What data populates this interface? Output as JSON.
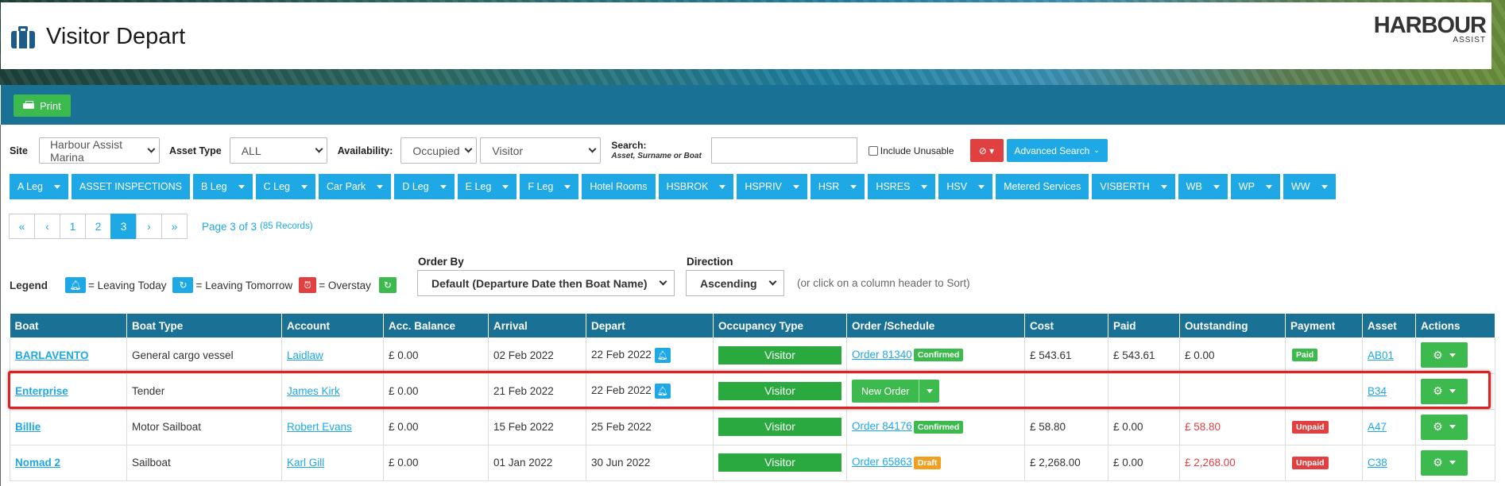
{
  "header": {
    "title": "Visitor Depart",
    "logo_brand": "HARBOUR",
    "logo_sub": "ASSIST"
  },
  "toolbar": {
    "print_label": "Print"
  },
  "filters": {
    "site_label": "Site",
    "site_value": "Harbour Assist Marina",
    "asset_type_label": "Asset Type",
    "asset_type_value": "ALL",
    "availability_label": "Availability:",
    "availability_value": "Occupied",
    "visitor_value": "Visitor",
    "search_label": "Search:",
    "search_hint": "Asset, Surname or Boat",
    "search_value": "",
    "include_unusable_label": "Include Unusable",
    "advanced_search_label": "Advanced Search"
  },
  "asset_chips": [
    "A Leg",
    "ASSET INSPECTIONS",
    "B Leg",
    "C Leg",
    "Car Park",
    "D Leg",
    "E Leg",
    "F Leg",
    "Hotel Rooms",
    "HSBROK",
    "HSPRIV",
    "HSR",
    "HSRES",
    "HSV",
    "Metered Services",
    "VISBERTH",
    "WB",
    "WP",
    "WW"
  ],
  "pagination": {
    "first": "«",
    "prev": "‹",
    "pages": [
      "1",
      "2",
      "3"
    ],
    "current": "3",
    "next": "›",
    "last": "»",
    "info": "Page 3 of 3",
    "records": "(85 Records)"
  },
  "legend": {
    "label": "Legend",
    "today": "= Leaving Today",
    "tomorrow": "= Leaving Tomorrow",
    "overstay": "= Overstay"
  },
  "order": {
    "order_by_label": "Order By",
    "order_by_value": "Default (Departure Date then Boat Name)",
    "direction_label": "Direction",
    "direction_value": "Ascending",
    "hint": "(or click on a column header to Sort)"
  },
  "table": {
    "headers": [
      "Boat",
      "Boat Type",
      "Account",
      "Acc. Balance",
      "Arrival",
      "Depart",
      "Occupancy Type",
      "Order /Schedule",
      "Cost",
      "Paid",
      "Outstanding",
      "Payment",
      "Asset",
      "Actions"
    ],
    "rows": [
      {
        "boat": "BARLAVENTO",
        "type": "General cargo vessel",
        "account": "Laidlaw",
        "balance": "£ 0.00",
        "arrival": "02 Feb 2022",
        "depart": "22 Feb 2022",
        "occupancy": "Visitor",
        "order": "Order 81340",
        "order_status": "Confirmed",
        "cost": "£ 543.61",
        "paid": "£ 543.61",
        "outstanding": "£ 0.00",
        "payment": "Paid",
        "asset": "AB01"
      },
      {
        "boat": "Enterprise",
        "type": "Tender",
        "account": "James Kirk",
        "balance": "£ 0.00",
        "arrival": "21 Feb 2022",
        "depart": "22 Feb 2022",
        "occupancy": "Visitor",
        "new_order": "New Order",
        "cost": "",
        "paid": "",
        "outstanding": "",
        "payment": "",
        "asset": "B34"
      },
      {
        "boat": "Billie",
        "type": "Motor Sailboat",
        "account": "Robert Evans",
        "balance": "£ 0.00",
        "arrival": "15 Feb 2022",
        "depart": "25 Feb 2022",
        "occupancy": "Visitor",
        "order": "Order 84176",
        "order_status": "Confirmed",
        "cost": "£ 58.80",
        "paid": "£ 0.00",
        "outstanding": "£ 58.80",
        "payment": "Unpaid",
        "asset": "A47"
      },
      {
        "boat": "Nomad 2",
        "type": "Sailboat",
        "account": "Karl Gill",
        "balance": "£ 0.00",
        "arrival": "01 Jan 2022",
        "depart": "30 Jun 2022",
        "occupancy": "Visitor",
        "order": "Order 65863",
        "order_status": "Draft",
        "cost": "£ 2,268.00",
        "paid": "£ 0.00",
        "outstanding": "£ 2,268.00",
        "payment": "Unpaid",
        "asset": "C38"
      }
    ]
  },
  "colors": {
    "accent": "#1ea8e6",
    "header_bar": "#1a7196",
    "success": "#3dba4e",
    "danger": "#e04040",
    "warning": "#f0a020",
    "highlight": "#e02020"
  }
}
